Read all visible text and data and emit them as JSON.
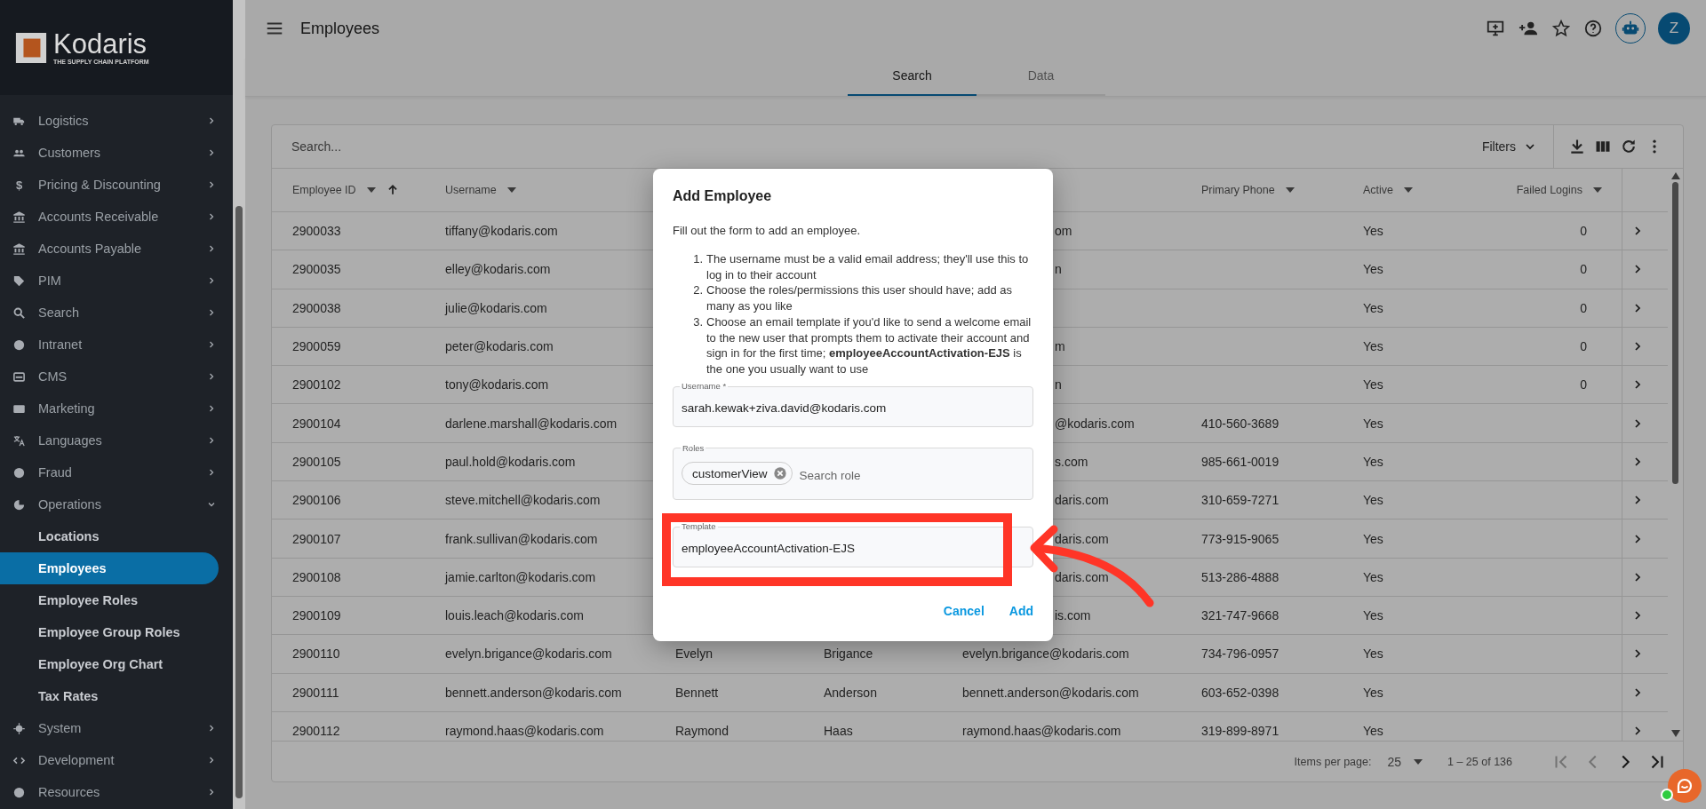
{
  "sidebar": {
    "logo": {
      "name": "Kodaris",
      "tagline": "THE SUPPLY CHAIN PLATFORM"
    },
    "items": [
      {
        "label": "Logistics",
        "expanded": false
      },
      {
        "label": "Customers",
        "expanded": false
      },
      {
        "label": "Pricing & Discounting",
        "glyph": "$",
        "expanded": false
      },
      {
        "label": "Accounts Receivable",
        "expanded": false
      },
      {
        "label": "Accounts Payable",
        "expanded": false
      },
      {
        "label": "PIM",
        "expanded": false
      },
      {
        "label": "Search",
        "expanded": false
      },
      {
        "label": "Intranet",
        "expanded": false
      },
      {
        "label": "CMS",
        "expanded": false
      },
      {
        "label": "Marketing",
        "expanded": false
      },
      {
        "label": "Languages",
        "expanded": false
      },
      {
        "label": "Fraud",
        "expanded": false
      },
      {
        "label": "Operations",
        "expanded": true,
        "children": [
          {
            "label": "Locations",
            "selected": false
          },
          {
            "label": "Employees",
            "selected": true
          },
          {
            "label": "Employee Roles",
            "selected": false
          },
          {
            "label": "Employee Group Roles",
            "selected": false
          },
          {
            "label": "Employee Org Chart",
            "selected": false
          },
          {
            "label": "Tax Rates",
            "selected": false
          }
        ]
      },
      {
        "label": "System",
        "expanded": false
      },
      {
        "label": "Development",
        "expanded": false
      },
      {
        "label": "Resources",
        "expanded": false
      }
    ]
  },
  "header": {
    "title": "Employees",
    "avatar": "Z"
  },
  "tabs": [
    {
      "label": "Search",
      "selected": true
    },
    {
      "label": "Data",
      "selected": false
    }
  ],
  "table": {
    "search": {
      "placeholder": "Search..."
    },
    "filters": "Filters",
    "columns": [
      {
        "label": "Employee ID",
        "sorted": true
      },
      {
        "label": "Username",
        "sorted": false
      },
      {
        "label": "Primary Phone",
        "sorted": false
      },
      {
        "label": "Active",
        "sorted": false
      },
      {
        "label": "Failed Logins",
        "sorted": false
      }
    ],
    "rows": [
      {
        "id": "2900033",
        "username": "tiffany@kodaris.com",
        "email_partial": "om",
        "active": "Yes",
        "failed_logins": "0"
      },
      {
        "id": "2900035",
        "username": "elley@kodaris.com",
        "email_partial": "n",
        "active": "Yes",
        "failed_logins": "0"
      },
      {
        "id": "2900038",
        "username": "julie@kodaris.com",
        "active": "Yes",
        "failed_logins": "0"
      },
      {
        "id": "2900059",
        "username": "peter@kodaris.com",
        "email_partial": "m",
        "active": "Yes",
        "failed_logins": "0"
      },
      {
        "id": "2900102",
        "username": "tony@kodaris.com",
        "email_partial": "n",
        "active": "Yes",
        "failed_logins": "0"
      },
      {
        "id": "2900104",
        "username": "darlene.marshall@kodaris.com",
        "email_partial": "@kodaris.com",
        "phone": "410-560-3689",
        "active": "Yes"
      },
      {
        "id": "2900105",
        "username": "paul.hold@kodaris.com",
        "email_partial": "s.com",
        "phone": "985-661-0019",
        "active": "Yes"
      },
      {
        "id": "2900106",
        "username": "steve.mitchell@kodaris.com",
        "email_partial": "daris.com",
        "phone": "310-659-7271",
        "active": "Yes"
      },
      {
        "id": "2900107",
        "username": "frank.sullivan@kodaris.com",
        "email_partial": "daris.com",
        "phone": "773-915-9065",
        "active": "Yes"
      },
      {
        "id": "2900108",
        "username": "jamie.carlton@kodaris.com",
        "email_partial": "daris.com",
        "phone": "513-286-4888",
        "active": "Yes"
      },
      {
        "id": "2900109",
        "username": "louis.leach@kodaris.com",
        "email_partial": "is.com",
        "phone": "321-747-9668",
        "active": "Yes"
      },
      {
        "id": "2900110",
        "username": "evelyn.brigance@kodaris.com",
        "first_name": "Evelyn",
        "last_name": "Brigance",
        "email": "evelyn.brigance@kodaris.com",
        "phone": "734-796-0957",
        "active": "Yes"
      },
      {
        "id": "2900111",
        "username": "bennett.anderson@kodaris.com",
        "first_name": "Bennett",
        "last_name": "Anderson",
        "email": "bennett.anderson@kodaris.com",
        "phone": "603-652-0398",
        "active": "Yes"
      },
      {
        "id": "2900112",
        "username": "raymond.haas@kodaris.com",
        "first_name": "Raymond",
        "last_name": "Haas",
        "email": "raymond.haas@kodaris.com",
        "phone": "319-899-8971",
        "active": "Yes"
      }
    ],
    "pagination": {
      "label": "Items per page:",
      "page_size": "25",
      "range": "1 – 25 of 136",
      "buttons": [
        {
          "kind": "first",
          "disabled": true
        },
        {
          "kind": "prev",
          "disabled": true
        },
        {
          "kind": "next",
          "disabled": false
        },
        {
          "kind": "last",
          "disabled": false
        }
      ]
    }
  },
  "dialog": {
    "title": "Add Employee",
    "intro": "Fill out the form to add an employee.",
    "steps": [
      {
        "number": "1.",
        "text": "The username must be a valid email address; they'll use this to log in to their account"
      },
      {
        "number": "2.",
        "text": "Choose the roles/permissions this user should have; add as many as you like"
      },
      {
        "number": "3.",
        "text": "Choose an email template if you'd like to send a welcome email to the new user that prompts them to activate their account and sign in for the first time; **employeeAccountActivation-EJS** is the one you usually want to use"
      }
    ],
    "username": {
      "label": "Username *",
      "value": "sarah.kewak+ziva.david@kodaris.com"
    },
    "roles": {
      "label": "Roles",
      "chips": [
        "customerView"
      ],
      "placeholder": "Search role"
    },
    "template": {
      "label": "Template",
      "value": "employeeAccountActivation-EJS"
    },
    "buttons": [
      "Cancel",
      "Add"
    ]
  }
}
